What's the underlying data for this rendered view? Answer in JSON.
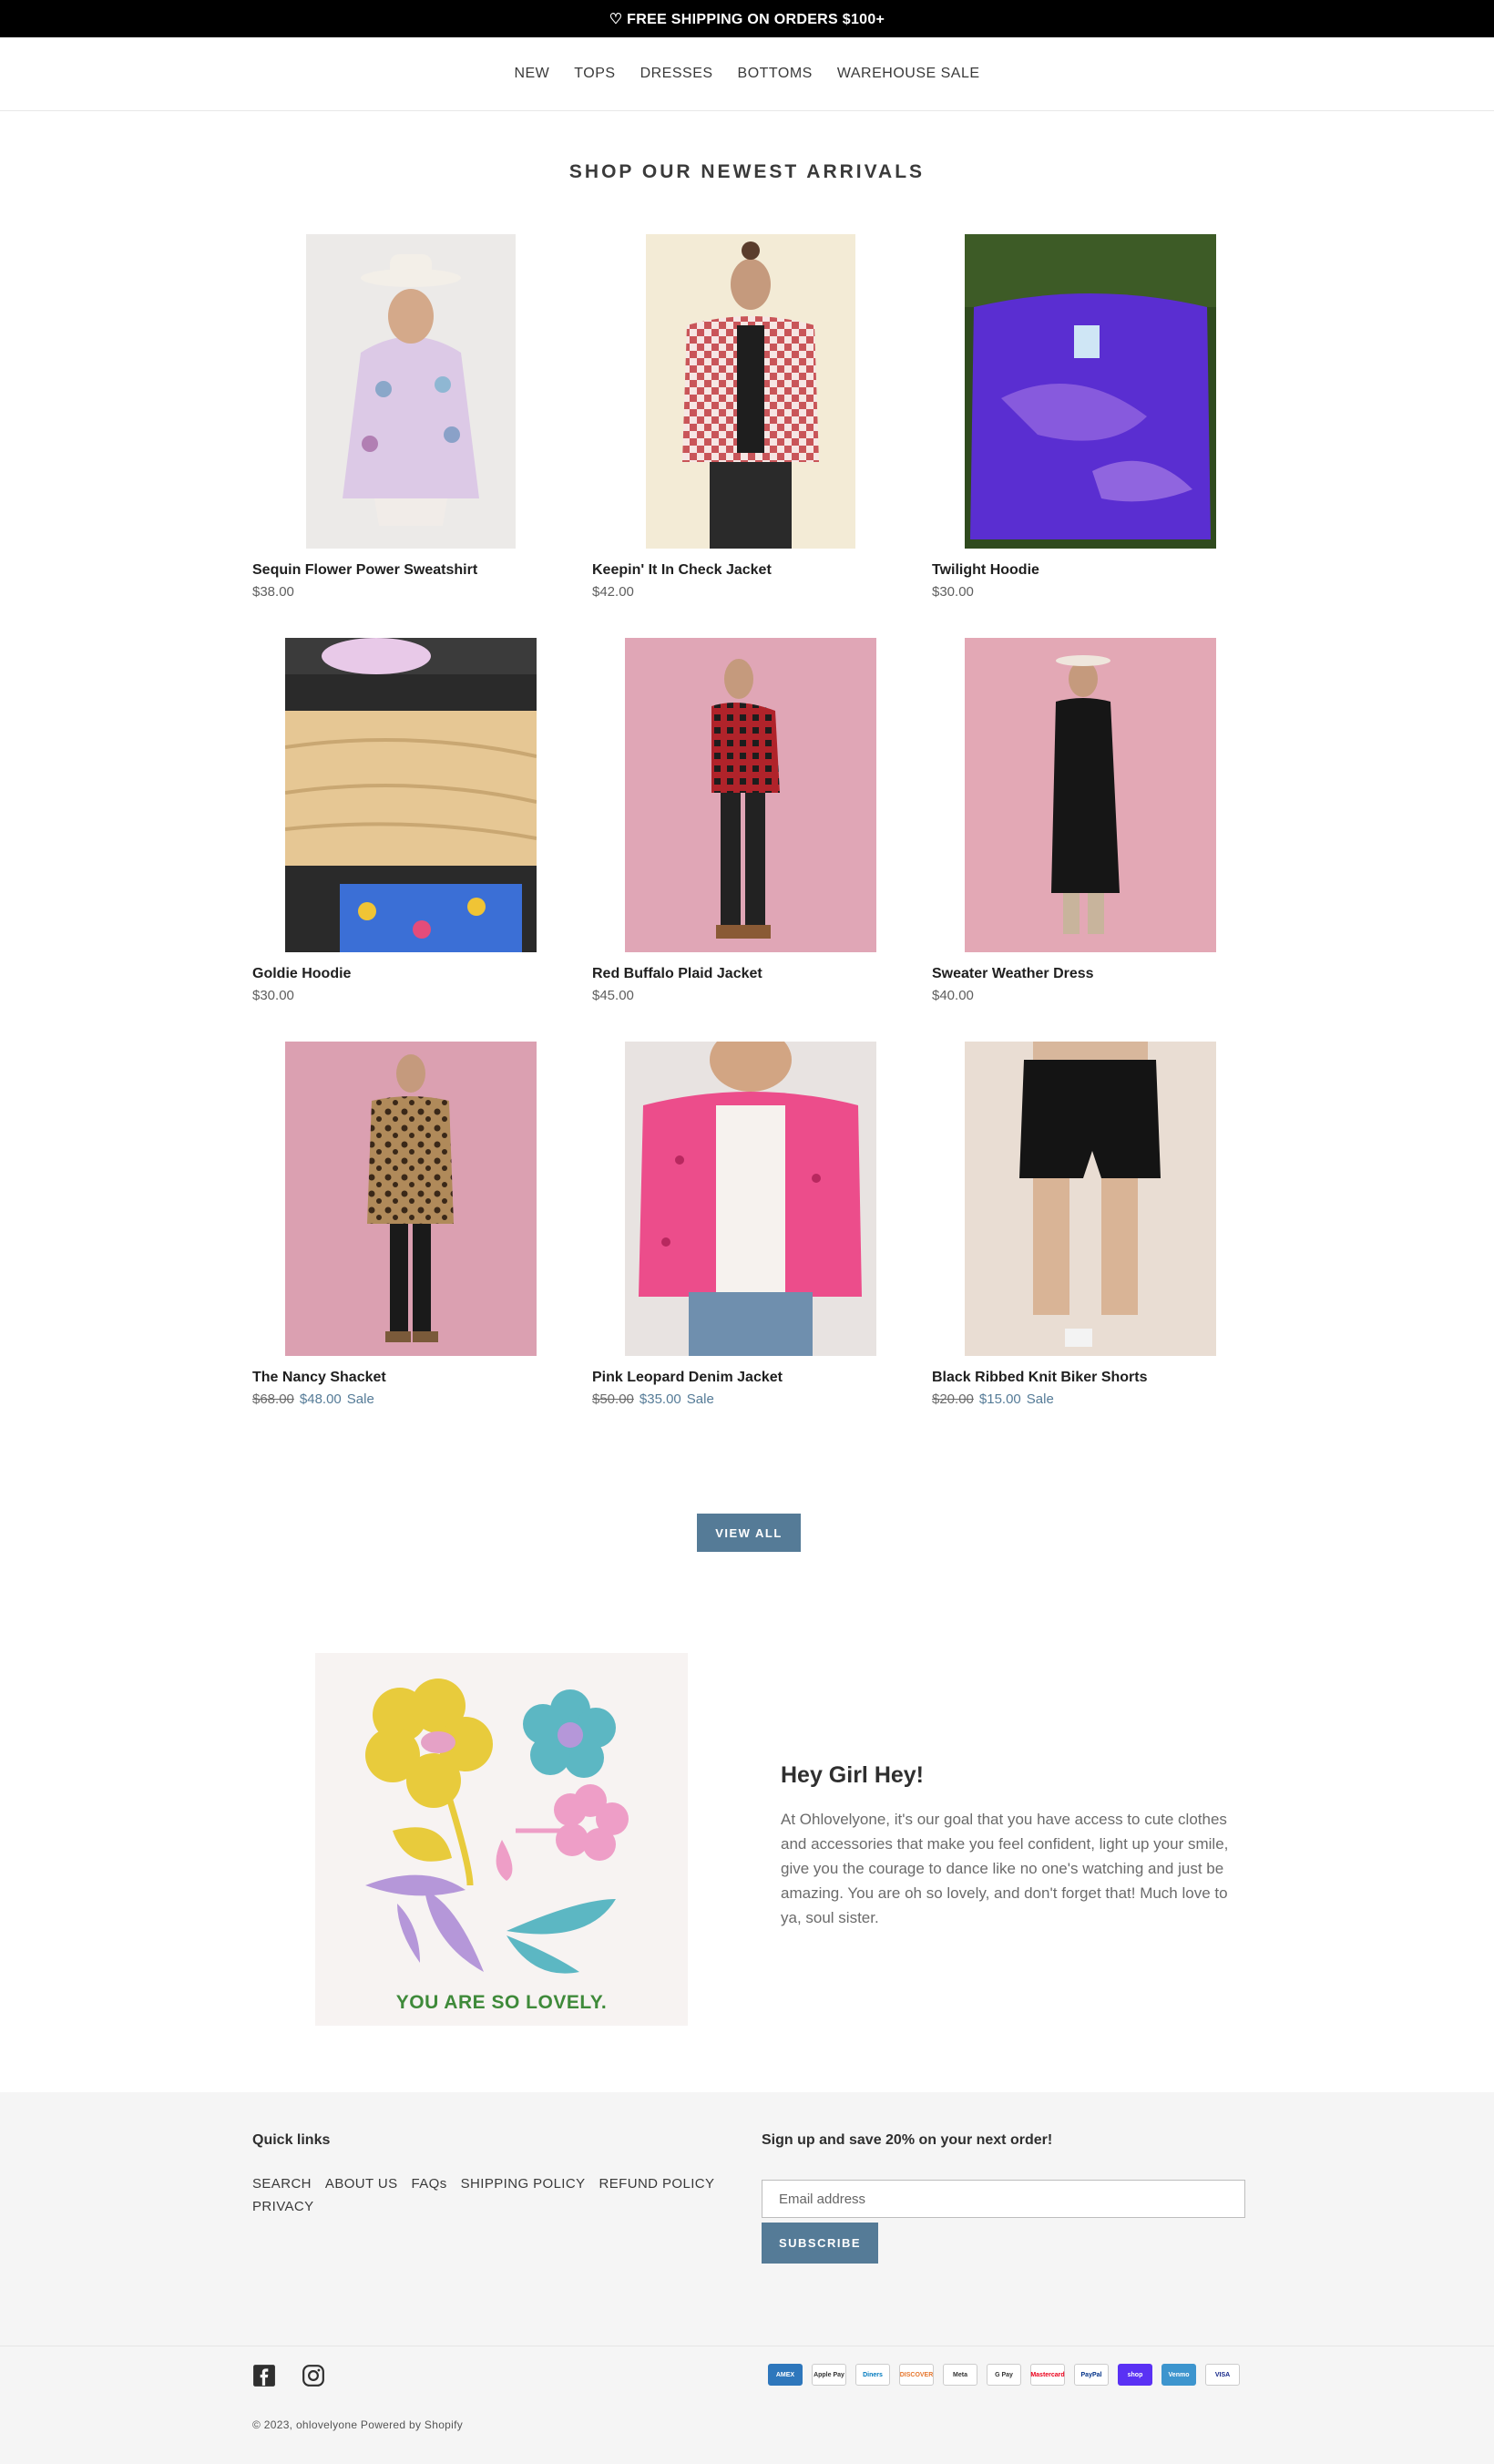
{
  "announcement": "♡ FREE SHIPPING ON ORDERS $100+",
  "nav": [
    "NEW",
    "TOPS",
    "DRESSES",
    "BOTTOMS",
    "WAREHOUSE SALE"
  ],
  "section_title": "SHOP OUR NEWEST ARRIVALS",
  "products": [
    {
      "name": "Sequin Flower Power Sweatshirt",
      "price": "$38.00"
    },
    {
      "name": "Keepin' It In Check Jacket",
      "price": "$42.00"
    },
    {
      "name": "Twilight Hoodie",
      "price": "$30.00"
    },
    {
      "name": "Goldie Hoodie",
      "price": "$30.00"
    },
    {
      "name": "Red Buffalo Plaid Jacket",
      "price": "$45.00"
    },
    {
      "name": "Sweater Weather Dress",
      "price": "$40.00"
    },
    {
      "name": "The Nancy Shacket",
      "old_price": "$68.00",
      "sale_price": "$48.00",
      "sale_label": "Sale"
    },
    {
      "name": "Pink Leopard Denim Jacket",
      "old_price": "$50.00",
      "sale_price": "$35.00",
      "sale_label": "Sale"
    },
    {
      "name": "Black Ribbed Knit Biker Shorts",
      "old_price": "$20.00",
      "sale_price": "$15.00",
      "sale_label": "Sale"
    }
  ],
  "view_all_label": "VIEW ALL",
  "feature": {
    "image_text": "YOU ARE SO LOVELY.",
    "heading": "Hey Girl Hey!",
    "body": "At Ohlovelyone, it's our goal that you have access to cute clothes and accessories that make you feel confident, light up your smile, give you the courage to dance like no one's watching and just be amazing. You are oh so lovely, and don't forget that! Much love to ya, soul sister."
  },
  "footer": {
    "quick_links_title": "Quick links",
    "quick_links": [
      "SEARCH",
      "ABOUT US",
      "FAQs",
      "SHIPPING POLICY",
      "REFUND POLICY",
      "PRIVACY"
    ],
    "newsletter_title": "Sign up and save 20% on your next order!",
    "email_placeholder": "Email address",
    "subscribe_label": "SUBSCRIBE",
    "payments": [
      "AMEX",
      "Apple Pay",
      "Diners",
      "DISCOVER",
      "Meta",
      "G Pay",
      "Mastercard",
      "PayPal",
      "shop",
      "Venmo",
      "VISA"
    ],
    "copyright": "© 2023, ohlovelyone Powered by Shopify"
  },
  "colors": {
    "accent": "#557b97",
    "announcement_bg": "#000000",
    "footer_bg": "#f5f5f5"
  }
}
